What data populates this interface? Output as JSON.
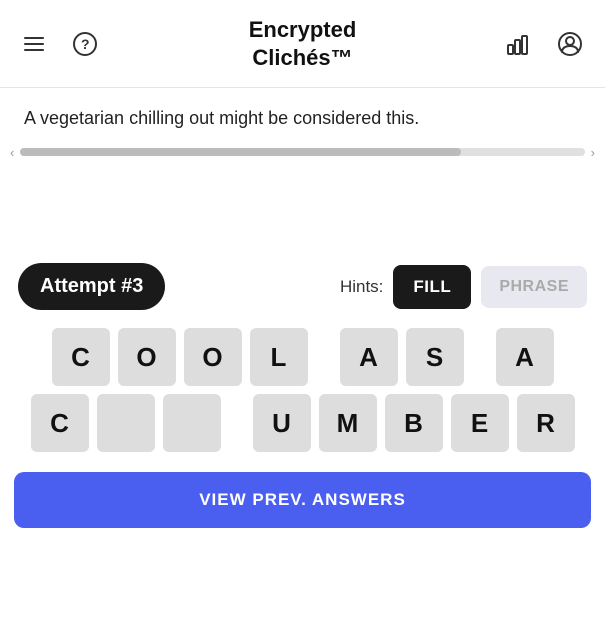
{
  "header": {
    "title_line1": "Encrypted",
    "title_line2": "Clichés™",
    "menu_icon": "☰",
    "help_icon": "?",
    "stats_icon": "📊",
    "user_icon": "👤"
  },
  "clue": {
    "text": "A vegetarian chilling out might be considered this."
  },
  "controls": {
    "attempt_label": "Attempt ",
    "attempt_number": "#3",
    "hints_label": "Hints:",
    "fill_button": "FILL",
    "phrase_button": "PHRASE"
  },
  "grid": {
    "row1": [
      "C",
      "O",
      "O",
      "L",
      "",
      "A",
      "S",
      "",
      "A"
    ],
    "row2": [
      "C",
      "",
      "",
      "U",
      "M",
      "B",
      "E",
      "R",
      ""
    ]
  },
  "footer": {
    "view_prev_button": "VIEW PREV. ANSWERS"
  },
  "colors": {
    "accent": "#4a5ef0",
    "dark": "#1a1a1a",
    "cell_bg": "#ddd"
  }
}
